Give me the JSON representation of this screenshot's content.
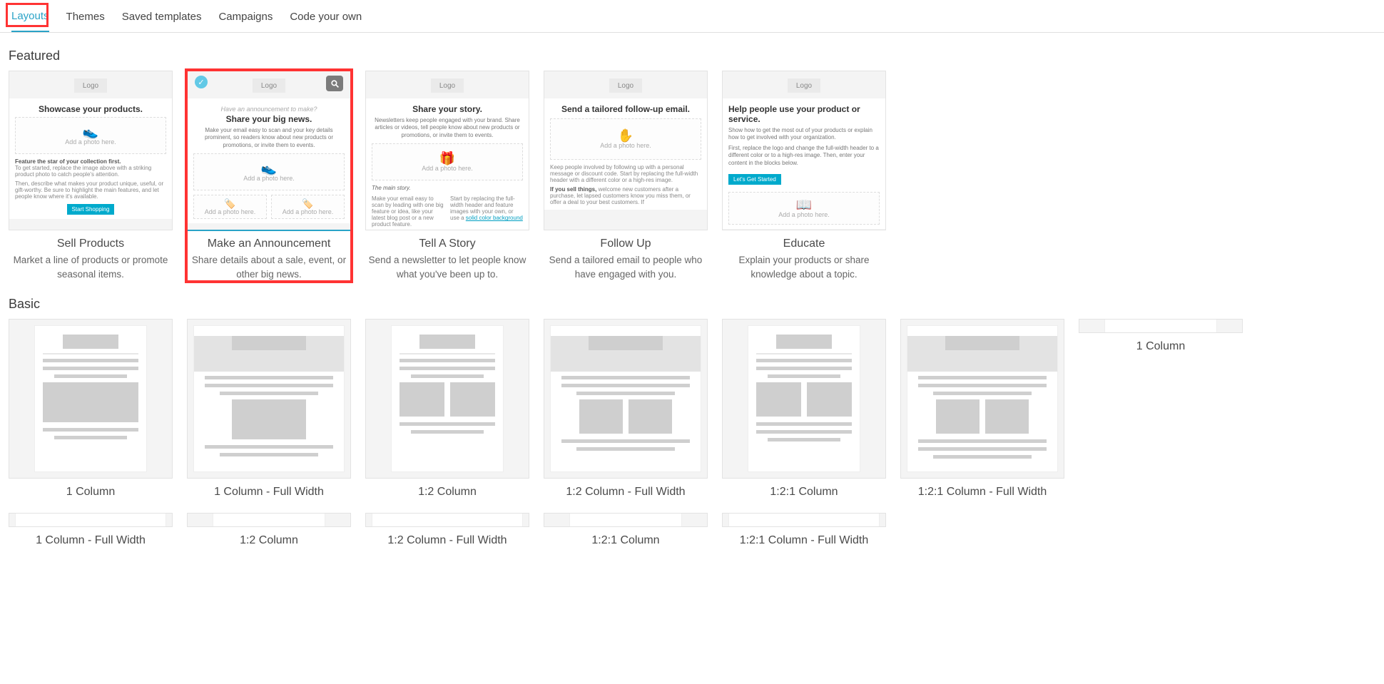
{
  "tabs": {
    "layouts": "Layouts",
    "themes": "Themes",
    "saved_templates": "Saved templates",
    "campaigns": "Campaigns",
    "code_your_own": "Code your own"
  },
  "sections": {
    "featured": "Featured",
    "basic": "Basic"
  },
  "featured": {
    "sell": {
      "title": "Sell Products",
      "desc": "Market a line of products or promote seasonal items.",
      "preview": {
        "logo": "Logo",
        "headline": "Showcase your products.",
        "ph": "Add a photo here.",
        "sub_bold": "Feature the star of your collection first.",
        "sub1": "To get started, replace the image above with a striking product photo to catch people's attention.",
        "sub2": "Then, describe what makes your product unique, useful, or gift-worthy. Be sure to highlight the main features, and let people know where it's available.",
        "btn": "Start Shopping"
      }
    },
    "announce": {
      "title": "Make an Announcement",
      "desc": "Share details about a sale, event, or other big news.",
      "preview": {
        "logo": "Logo",
        "pre": "Have an announcement to make?",
        "headline": "Share your big news.",
        "sub": "Make your email easy to scan and your key details prominent, so readers know about new products or promotions, or invite them to events.",
        "ph_main": "Add a photo here.",
        "ph_small": "Add a photo here."
      }
    },
    "story": {
      "title": "Tell A Story",
      "desc": "Send a newsletter to let people know what you've been up to.",
      "preview": {
        "logo": "Logo",
        "headline": "Share your story.",
        "sub": "Newsletters keep people engaged with your brand. Share articles or videos, tell people know about new products or promotions, or invite them to events.",
        "ph": "Add a photo here.",
        "col_head": "The main story.",
        "col1": "Make your email easy to scan by leading with one big feature or idea, like your latest blog post or a new product feature.",
        "col2a": "Start by replacing the full-width header and feature images with your own, or use a ",
        "col2b": "solid color background"
      }
    },
    "follow": {
      "title": "Follow Up",
      "desc": "Send a tailored email to people who have engaged with you.",
      "preview": {
        "logo": "Logo",
        "headline": "Send a tailored follow-up email.",
        "ph": "Add a photo here.",
        "sub1": "Keep people involved by following up with a personal message or discount code. Start by replacing the full-width header with a different color or a high-res image.",
        "sub2a": "If you sell things,",
        "sub2b": " welcome new customers after a purchase, let lapsed customers know you miss them, or offer a deal to your best customers. If"
      }
    },
    "educate": {
      "title": "Educate",
      "desc": "Explain your products or share knowledge about a topic.",
      "preview": {
        "logo": "Logo",
        "headline": "Help people use your product or service.",
        "sub1": "Show how to get the most out of your products or explain how to get involved with your organization.",
        "sub2": "First, replace the logo and change the full-width header to a different color or to a high-res image. Then, enter your content in the blocks below.",
        "btn": "Let's Get Started",
        "ph": "Add a photo here."
      }
    }
  },
  "basic": {
    "col1": "1 Column",
    "col1_fw": "1 Column - Full Width",
    "col12": "1:2 Column",
    "col12_fw": "1:2 Column - Full Width",
    "col121": "1:2:1 Column",
    "col121_fw": "1:2:1 Column - Full Width"
  },
  "basic_repeat": {
    "col1": "1 Column",
    "col1_fw": "1 Column - Full Width",
    "col12": "1:2 Column",
    "col12_fw": "1:2 Column - Full Width",
    "col121": "1:2:1 Column",
    "col121_fw": "1:2:1 Column - Full Width"
  }
}
